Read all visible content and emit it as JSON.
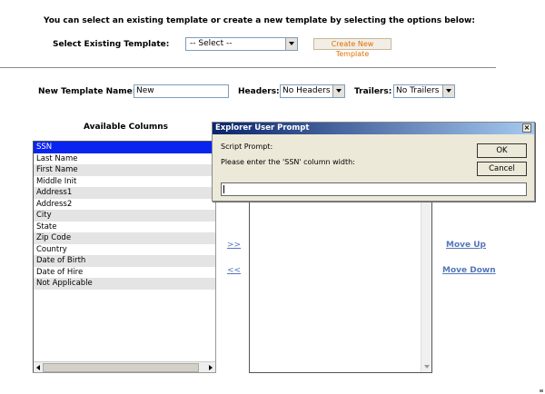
{
  "page": {
    "instruction": "You can select an existing template or create a new template by selecting the options below:",
    "select_label": "Select Existing Template:",
    "select_value": "-- Select --",
    "create_button": "Create New Template"
  },
  "form": {
    "name_label": "New Template Name:",
    "name_value": "New",
    "headers_label": "Headers:",
    "headers_value": "No Headers",
    "trailers_label": "Trailers:",
    "trailers_value": "No Trailers"
  },
  "available": {
    "title": "Available Columns",
    "items": [
      "SSN",
      "Last Name",
      "First Name",
      "Middle Init",
      "Address1",
      "Address2",
      "City",
      "State",
      "Zip Code",
      "Country",
      "Date of Birth",
      "Date of Hire",
      "Not Applicable"
    ],
    "selected_index": 0
  },
  "transfer": {
    "add": ">>",
    "remove": "<<"
  },
  "ordering": {
    "move_up": "Move Up",
    "move_down": "Move Down"
  },
  "dialog": {
    "title": "Explorer User Prompt",
    "close": "×",
    "prompt_label": "Script Prompt:",
    "prompt_text": "Please enter the 'SSN' column width:",
    "ok": "OK",
    "cancel": "Cancel",
    "input_value": ""
  }
}
